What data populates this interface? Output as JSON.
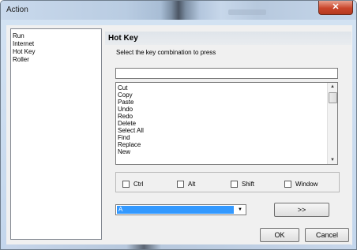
{
  "window": {
    "title": "Action",
    "close_glyph": "✕"
  },
  "sidebar": {
    "items": [
      {
        "label": "Run"
      },
      {
        "label": "Internet"
      },
      {
        "label": "Hot Key"
      },
      {
        "label": "Roller"
      }
    ]
  },
  "panel": {
    "header": "Hot Key",
    "instruction": "Select the key combination to press",
    "key_input_value": ""
  },
  "commands": {
    "items": [
      "Cut",
      "Copy",
      "Paste",
      "Undo",
      "Redo",
      "Delete",
      "Select All",
      "Find",
      "Replace",
      "New"
    ],
    "scroll_up_glyph": "▲",
    "scroll_down_glyph": "▼"
  },
  "modifiers": {
    "ctrl": "Ctrl",
    "alt": "Alt",
    "shift": "Shift",
    "window": "Window"
  },
  "key_select": {
    "selected": "A",
    "dropdown_glyph": "▼"
  },
  "buttons": {
    "add": ">>",
    "ok": "OK",
    "cancel": "Cancel"
  }
}
